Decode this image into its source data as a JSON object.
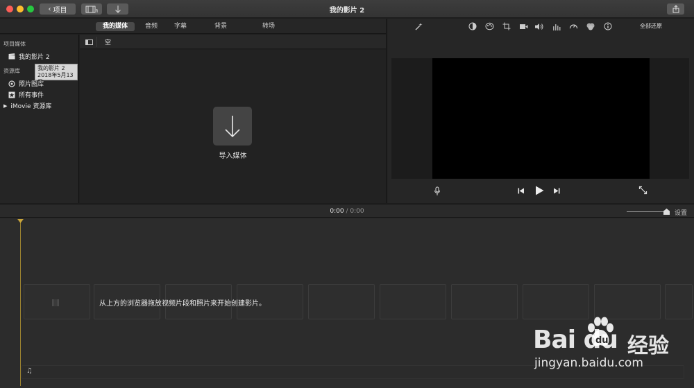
{
  "window": {
    "title": "我的影片 2",
    "back_button_label": "项目"
  },
  "browser_tabs": [
    {
      "label": "我的媒体",
      "active": true
    },
    {
      "label": "音频",
      "active": false
    },
    {
      "label": "字幕",
      "active": false
    },
    {
      "label": "背景",
      "active": false
    },
    {
      "label": "转场",
      "active": false
    }
  ],
  "sidebar": {
    "project_media_heading": "项目媒体",
    "project_item": "我的影片 2",
    "tooltip_title": "我的影片 2",
    "tooltip_date": "2018年5月13日",
    "library_heading": "资源库",
    "items": [
      {
        "label": "照片图库",
        "icon": "photos-icon"
      },
      {
        "label": "所有事件",
        "icon": "star-icon"
      }
    ],
    "imovie_library": "iMovie 资源库"
  },
  "media": {
    "filter_label": "空",
    "import_label": "导入媒体"
  },
  "viewer": {
    "reset_all_label": "全部还原",
    "adjustment_icons": [
      "magic-wand-icon",
      "color-balance-icon",
      "color-palette-icon",
      "crop-icon",
      "stabilization-icon",
      "volume-icon",
      "equalizer-icon",
      "speed-icon",
      "filter-icon",
      "info-icon"
    ]
  },
  "timeline": {
    "current_time": "0:00",
    "separator": "/",
    "total_time": "0:00",
    "settings_label": "设置",
    "hint": "从上方的浏览器拖放视频片段和照片来开始创建影片。"
  },
  "watermark": {
    "brand": "Bai  du",
    "suffix": "经验",
    "url": "jingyan.baidu.com"
  },
  "colors": {
    "close": "#fc5e57",
    "minimize": "#fdbc2e",
    "zoom": "#27c840",
    "playhead": "#c9a53b"
  }
}
